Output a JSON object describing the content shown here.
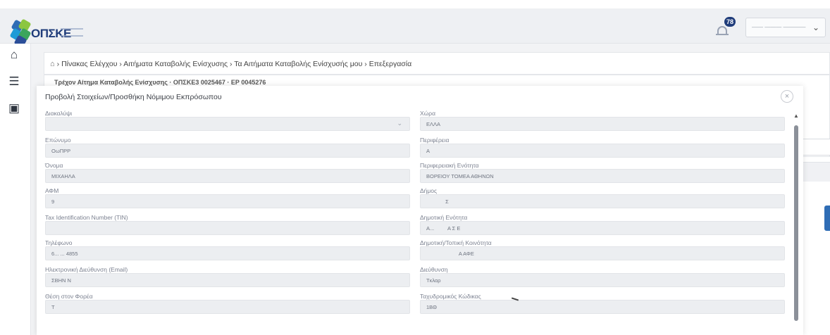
{
  "header": {
    "brand": "ΟΠΣΚΕ",
    "notification_count": "78",
    "user_select_value": "—— ——— ————",
    "user_chevron": "⌄"
  },
  "rail": {
    "icons": [
      "home-icon",
      "sliders-icon",
      "screen-icon"
    ]
  },
  "breadcrumb": {
    "home_glyph": "⌂",
    "text": "› Πίνακας Ελέγχου › Αιτήματα Καταβολής Ενίσχυσης › Τα Αιτήματα Καταβολής Ενίσχυσής μου › Επεξεργασία"
  },
  "behind": {
    "title": "Τρέχον Αίτημα Καταβολής Ενίσχυσης · ΟΠΣΚΕ3 0025467 · ΕΡ 0045276"
  },
  "modal": {
    "title": "Προβολή Στοιχείων/Προσθήκη Νόμιμου Εκπρόσωπου",
    "close_glyph": "×",
    "left_fields": [
      {
        "label": "Διακαλύψι",
        "value": "",
        "select": true
      },
      {
        "label": "Επώνυμο",
        "value": "ΟωΠΡΡ",
        "select": false
      },
      {
        "label": "Όνομα",
        "value": "ΜΙΧΑΗΛΑ",
        "select": false
      },
      {
        "label": "ΑΦΜ",
        "value": "9",
        "select": false
      },
      {
        "label": "Tax Identification Number (TIN)",
        "value": "",
        "select": false
      },
      {
        "label": "Τηλέφωνο",
        "value": "6... ... 4855",
        "select": false
      },
      {
        "label": "Ηλεκτρονική Διεύθυνση (Email)",
        "value": "ΣΒΗΝ Ν",
        "select": false
      },
      {
        "label": "Θέση στον Φορέα",
        "value": "Τ",
        "select": false
      }
    ],
    "right_fields": [
      {
        "label": "Χώρα",
        "value": "ΕΛΛΑ"
      },
      {
        "label": "Περιφέρεια",
        "value": "Α"
      },
      {
        "label": "Περιφερειακή Ενότητα",
        "value": "ΒΟΡΕΙΟΥ ΤΟΜΕΑ ΑΘΗΝΩΝ"
      },
      {
        "label": "Δήμος",
        "value": "             Σ"
      },
      {
        "label": "Δημοτική Ενότητα",
        "value": "Α...         Α Σ Ε"
      },
      {
        "label": "Δημοτική/Τοπική Κοινότητα",
        "value": "                      Α ΑΦΕ"
      },
      {
        "label": "Διεύθυνση",
        "value": "Τκλαρ"
      },
      {
        "label": "Ταχυδρομικός Κώδικας",
        "value": "1ΒΘ"
      }
    ]
  },
  "colors": {
    "brand_blue": "#1f3c7a",
    "field_bg": "#eceef1",
    "accent_blue": "#2f6db5"
  }
}
